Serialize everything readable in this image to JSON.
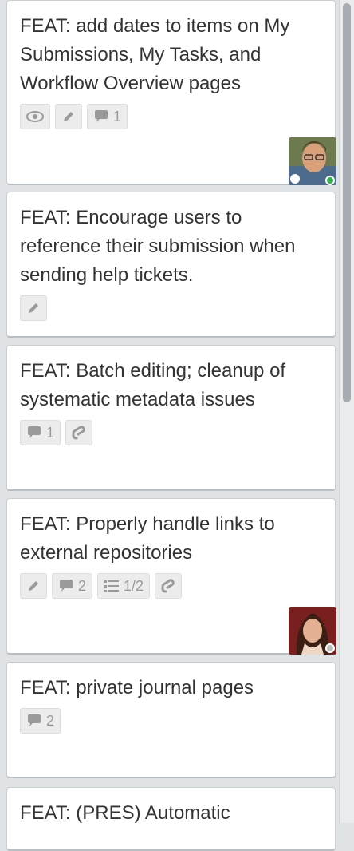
{
  "cards": [
    {
      "title": "FEAT: add dates to items on My Submissions, My Tasks, and Workflow Overview pages",
      "badges": {
        "comments": "1"
      }
    },
    {
      "title": "FEAT: Encourage users to reference their submission when sending help tickets."
    },
    {
      "title": "FEAT: Batch editing; cleanup of systematic metadata issues",
      "badges": {
        "comments": "1"
      }
    },
    {
      "title": "FEAT: Properly handle links to external repositories",
      "badges": {
        "comments": "2",
        "checklist": "1/2"
      }
    },
    {
      "title": "FEAT: private journal pages",
      "badges": {
        "comments": "2"
      }
    },
    {
      "title": "FEAT: (PRES) Automatic"
    }
  ],
  "icons": {
    "watch": "eye-icon",
    "description": "pencil-icon",
    "comments": "speech-bubble-icon",
    "checklist": "checklist-icon",
    "attachment": "paperclip-icon"
  },
  "colors": {
    "badge_icon": "#9a9a9a",
    "online_dot": "#2fb24c",
    "list_bg": "#dfe3e6"
  }
}
